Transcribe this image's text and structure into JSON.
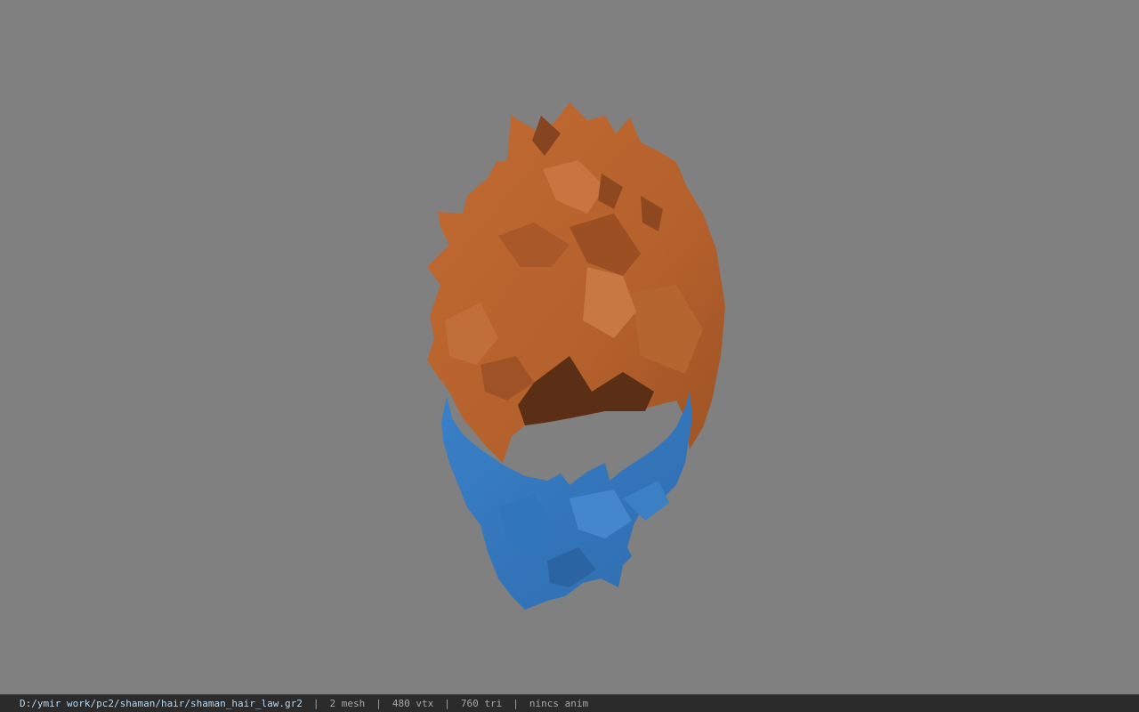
{
  "viewer": {
    "colors": {
      "background": "#808080",
      "hair": "#b8642f",
      "hair_shadow": "#5a3018",
      "beard": "#3b7fc4"
    },
    "meshes": [
      "hair",
      "beard"
    ]
  },
  "status": {
    "path": "D:/ymir work/pc2/shaman/hair/shaman_hair_law.gr2",
    "mesh": "2 mesh",
    "vtx": "480 vtx",
    "tri": "760 tri",
    "anim": "nincs anim",
    "separator": "|"
  }
}
